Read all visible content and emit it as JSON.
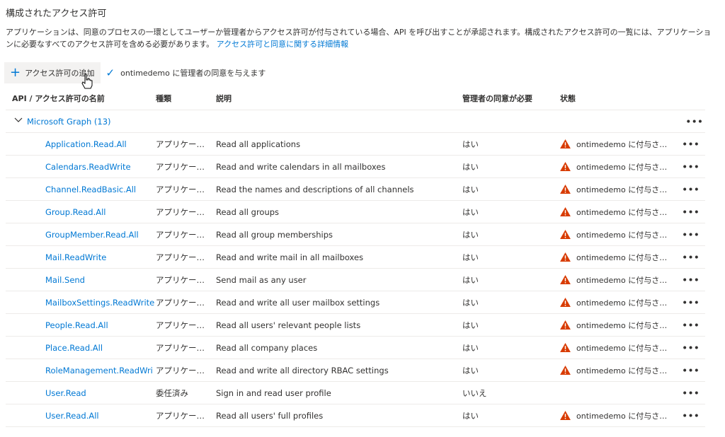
{
  "section_title": "構成されたアクセス許可",
  "description": {
    "text": "アプリケーションは、同意のプロセスの一環としてユーザーか管理者からアクセス許可が付与されている場合、API を呼び出すことが承認されます。構成されたアクセス許可の一覧には、アプリケーションに必要なすべてのアクセス許可を含める必要があります。",
    "link": "アクセス許可と同意に関する詳細情報"
  },
  "toolbar": {
    "add_permission_label": "アクセス許可の追加",
    "grant_consent_label": "ontimedemo に管理者の同意を与えます"
  },
  "table": {
    "headers": {
      "name": "API / アクセス許可の名前",
      "type": "種類",
      "description": "説明",
      "admin_consent": "管理者の同意が必要",
      "status": "状態"
    },
    "group": {
      "name": "Microsoft Graph (13)",
      "more": "•••"
    },
    "rows": [
      {
        "name": "Application.Read.All",
        "type": "アプリケー…",
        "desc": "Read all applications",
        "admin": "はい",
        "status": "ontimedemo に付与さ…",
        "warn": true,
        "more": "•••"
      },
      {
        "name": "Calendars.ReadWrite",
        "type": "アプリケー…",
        "desc": "Read and write calendars in all mailboxes",
        "admin": "はい",
        "status": "ontimedemo に付与さ…",
        "warn": true,
        "more": "•••"
      },
      {
        "name": "Channel.ReadBasic.All",
        "type": "アプリケー…",
        "desc": "Read the names and descriptions of all channels",
        "admin": "はい",
        "status": "ontimedemo に付与さ…",
        "warn": true,
        "more": "•••"
      },
      {
        "name": "Group.Read.All",
        "type": "アプリケー…",
        "desc": "Read all groups",
        "admin": "はい",
        "status": "ontimedemo に付与さ…",
        "warn": true,
        "more": "•••"
      },
      {
        "name": "GroupMember.Read.All",
        "type": "アプリケー…",
        "desc": "Read all group memberships",
        "admin": "はい",
        "status": "ontimedemo に付与さ…",
        "warn": true,
        "more": "•••"
      },
      {
        "name": "Mail.ReadWrite",
        "type": "アプリケー…",
        "desc": "Read and write mail in all mailboxes",
        "admin": "はい",
        "status": "ontimedemo に付与さ…",
        "warn": true,
        "more": "•••"
      },
      {
        "name": "Mail.Send",
        "type": "アプリケー…",
        "desc": "Send mail as any user",
        "admin": "はい",
        "status": "ontimedemo に付与さ…",
        "warn": true,
        "more": "•••"
      },
      {
        "name": "MailboxSettings.ReadWrite",
        "type": "アプリケー…",
        "desc": "Read and write all user mailbox settings",
        "admin": "はい",
        "status": "ontimedemo に付与さ…",
        "warn": true,
        "more": "•••"
      },
      {
        "name": "People.Read.All",
        "type": "アプリケー…",
        "desc": "Read all users' relevant people lists",
        "admin": "はい",
        "status": "ontimedemo に付与さ…",
        "warn": true,
        "more": "•••"
      },
      {
        "name": "Place.Read.All",
        "type": "アプリケー…",
        "desc": "Read all company places",
        "admin": "はい",
        "status": "ontimedemo に付与さ…",
        "warn": true,
        "more": "•••"
      },
      {
        "name": "RoleManagement.ReadWri",
        "type": "アプリケー…",
        "desc": "Read and write all directory RBAC settings",
        "admin": "はい",
        "status": "ontimedemo に付与さ…",
        "warn": true,
        "more": "•••"
      },
      {
        "name": "User.Read",
        "type": "委任済み",
        "desc": "Sign in and read user profile",
        "admin": "いいえ",
        "status": "",
        "warn": false,
        "more": "•••"
      },
      {
        "name": "User.Read.All",
        "type": "アプリケー…",
        "desc": "Read all users' full profiles",
        "admin": "はい",
        "status": "ontimedemo に付与さ…",
        "warn": true,
        "more": "•••"
      }
    ]
  },
  "colors": {
    "accent": "#0078d4",
    "warning": "#d83b01",
    "border": "#edebe9"
  }
}
